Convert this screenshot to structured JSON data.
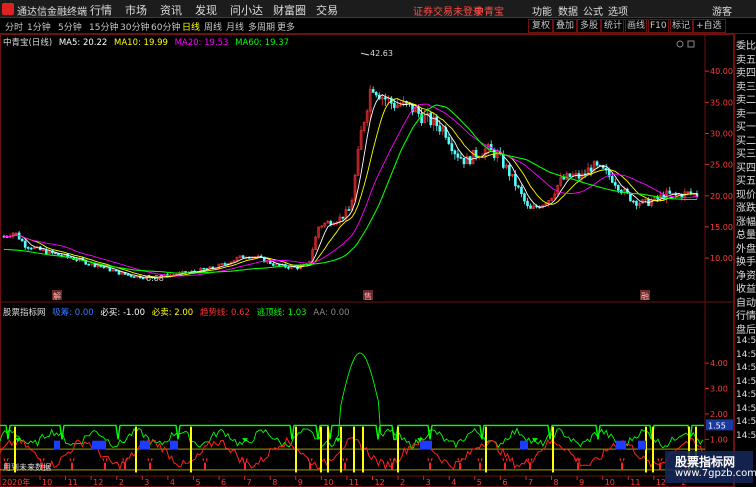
{
  "app": {
    "title": "通达信金融终端"
  },
  "menu": [
    "行情",
    "市场",
    "资讯",
    "发现",
    "问小达",
    "财富圈",
    "交易"
  ],
  "notice": "证券交易未登录",
  "header_stock": "中青宝",
  "right_menu": [
    "功能",
    "数据",
    "公式",
    "选项",
    "游客"
  ],
  "periods": [
    "分时",
    "1分钟",
    "5分钟",
    "15分钟",
    "30分钟",
    "60分钟",
    "日线",
    "周线",
    "月线",
    "多周期",
    "更多"
  ],
  "active_period": "日线",
  "tools": [
    "复权",
    "叠加",
    "多股",
    "统计",
    "画线",
    "F10",
    "标记",
    "+自选"
  ],
  "main_chart": {
    "title": "中青宝(日线)",
    "ma5": "MA5: 20.22",
    "ma10": "MA10: 19.99",
    "ma20": "MA20: 19.53",
    "ma60": "MA60: 19.37",
    "high_label": "42.63",
    "low_label": "6.68",
    "markers": [
      "解",
      "售",
      "融"
    ]
  },
  "indicator": {
    "title": "股票指标网",
    "v1": "吸筹: 0.00",
    "v2": "必买: -1.00",
    "v3": "必卖: 2.00",
    "v4": "趋势线: 0.62",
    "v5": "逃顶线: 1.03",
    "v6": "AA: 0.00",
    "note": "用到未来数据",
    "current_value": "1.55"
  },
  "bottom_axis": {
    "year": "2020年",
    "months": [
      "10",
      "11",
      "12",
      "2",
      "3",
      "4",
      "5",
      "6",
      "7",
      "8",
      "9",
      "10",
      "11",
      "12",
      "2",
      "3",
      "4",
      "5",
      "6",
      "7",
      "8",
      "9",
      "10",
      "11",
      "12",
      "2"
    ]
  },
  "right_panel": {
    "items": [
      "委比",
      "卖五",
      "卖四",
      "卖三",
      "卖二",
      "卖一",
      "买一",
      "买二",
      "买三",
      "买四",
      "买五",
      "现价",
      "涨跌",
      "涨幅",
      "总量",
      "外盘",
      "换手",
      "净资",
      "收益",
      "自动",
      "行情",
      "盘后"
    ],
    "times": [
      "14:5",
      "14:5",
      "14:5",
      "14:5",
      "14:5",
      "14:5",
      "14:5",
      "14:5"
    ]
  },
  "watermark": {
    "line1": "股票指标网",
    "line2": "www.7gpzb.com"
  },
  "colors": {
    "ma5": "#ffffff",
    "ma10": "#ffff00",
    "ma20": "#ff00ff",
    "ma60": "#00ff00",
    "up": "#ff3232",
    "down": "#54ffff",
    "accent": "#ffff00"
  },
  "chart_data": {
    "type": "candlestick",
    "y_axis_ticks": [
      10.0,
      15.0,
      20.0,
      25.0,
      30.0,
      35.0,
      40.0
    ],
    "ylim": [
      6,
      45
    ],
    "indicator_ticks": [
      0.0,
      1.0,
      2.0,
      3.0,
      4.0
    ],
    "indicator_ylim": [
      -0.4,
      5.3
    ],
    "close_path": [
      13.5,
      14.2,
      12.1,
      11.5,
      11.0,
      10.6,
      10.2,
      9.8,
      9.2,
      8.8,
      8.2,
      7.6,
      7.2,
      7.0,
      6.9,
      7.1,
      7.3,
      7.6,
      7.8,
      8.2,
      8.4,
      9.1,
      9.8,
      10.4,
      10.2,
      9.5,
      8.8,
      8.6,
      8.5,
      9.0,
      15.2,
      15.8,
      16.4,
      17.8,
      30.0,
      38.0,
      36.0,
      34.8,
      34.5,
      33.9,
      32.5,
      31.7,
      30.5,
      27.0,
      25.5,
      26.8,
      27.5,
      26.5,
      24.0,
      21.0,
      17.6,
      18.5,
      19.6,
      22.4,
      23.2,
      23.0,
      24.8,
      24.0,
      22.7,
      20.6,
      19.2,
      18.8,
      19.3,
      20.2,
      20.0,
      20.4,
      20.2
    ],
    "ma60_path": [
      11.4,
      11.3,
      11.1,
      10.8,
      10.5,
      10.3,
      10.0,
      9.6,
      9.2,
      8.8,
      8.5,
      8.2,
      8.0,
      7.9,
      7.8,
      7.6,
      7.6,
      7.6,
      7.7,
      7.8,
      7.9,
      8.1,
      8.3,
      8.4,
      8.6,
      8.8,
      8.9,
      9.0,
      9.2,
      9.6,
      10.3,
      12.0,
      15.0,
      18.5,
      23.0,
      27.5,
      31.0,
      33.5,
      34.6,
      34.2,
      32.5,
      30.6,
      28.4,
      27.0,
      26.6,
      26.2,
      25.8,
      24.8,
      23.8,
      23.2,
      22.7,
      22.1,
      21.6,
      21.1,
      20.7,
      20.4,
      20.3,
      20.0,
      19.7,
      19.5,
      19.4,
      19.4
    ]
  }
}
